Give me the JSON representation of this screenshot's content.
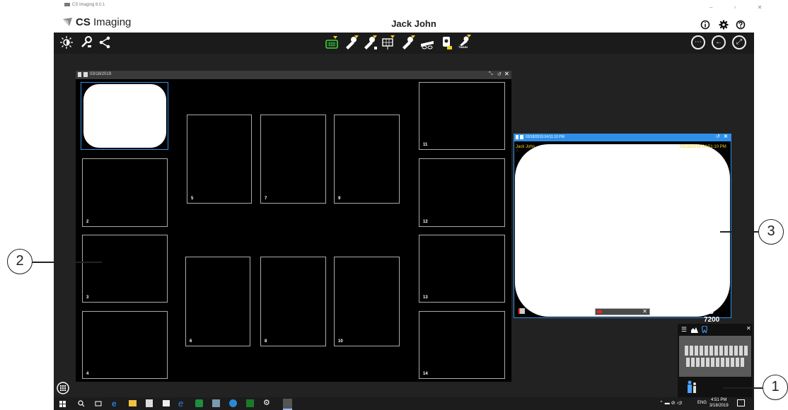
{
  "window": {
    "app_name": "CS Imaging 8.0.1",
    "logo_text_bold": "CS",
    "logo_text_light": "Imaging",
    "patient_name": "Jack John",
    "controls": "–  ▫  ✕"
  },
  "header_icons": [
    "info-icon",
    "settings-icon",
    "help-icon"
  ],
  "toolbar": {
    "left_tools": [
      "brightness-icon",
      "tools-icon",
      "share-icon"
    ],
    "acquisition_tools": [
      "intraoral-sensor-icon",
      "acquire-1-icon",
      "acquire-2-icon",
      "acquire-template-icon",
      "acquire-3-icon",
      "panoramic-icon",
      "intraoral-camera-icon",
      "twain-icon"
    ],
    "twain_label": "TWAIN",
    "right_tools": [
      "more-icon",
      "back-icon",
      "fullscreen-icon"
    ]
  },
  "template": {
    "date": "03/18/2019",
    "slots": [
      "",
      "2",
      "3",
      "4",
      "5",
      "6",
      "7",
      "8",
      "9",
      "10",
      "11",
      "12",
      "13",
      "14"
    ]
  },
  "viewer": {
    "title": "03/18/2019 04:51:10 PM",
    "patient_overlay": "Jack John",
    "date_overlay": "03/18/2019 04:51:10 PM",
    "orientation_mark": "R",
    "device_label": "CS 7200"
  },
  "thumbnail_panel": {
    "tabs": [
      "list-icon",
      "chart-icon",
      "tooth-icon"
    ]
  },
  "taskbar": {
    "time": "4:51 PM",
    "date": "3/18/2019",
    "language": "ENG"
  },
  "callouts": [
    "1",
    "2",
    "3"
  ],
  "colors": {
    "app_background": "#222222",
    "viewer_border": "#2f8fe8",
    "acq_icon_yellow": "#f5d020",
    "sensor_green": "#3bd43b",
    "date_overlay": "#f5d020"
  }
}
